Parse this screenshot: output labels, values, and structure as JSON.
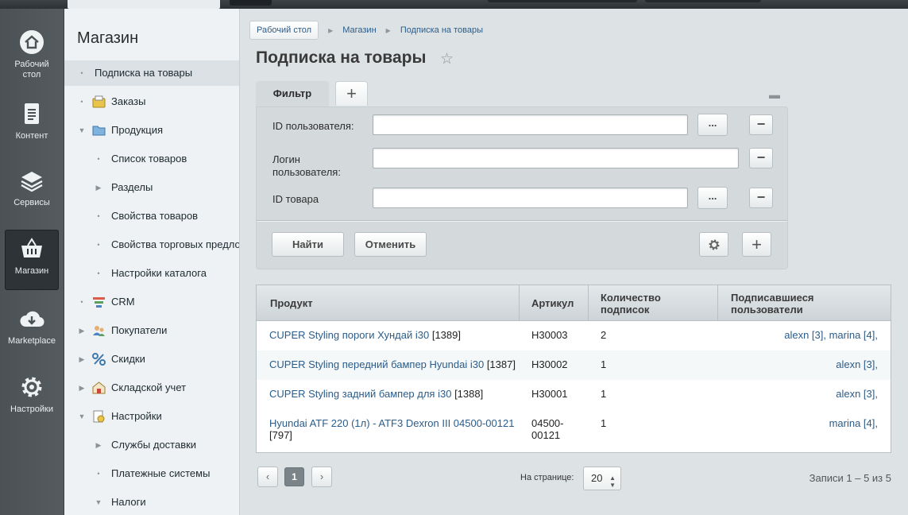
{
  "nav": [
    {
      "label": "Рабочий стол",
      "icon": "home-icon"
    },
    {
      "label": "Контент",
      "icon": "document-icon"
    },
    {
      "label": "Сервисы",
      "icon": "layers-icon"
    },
    {
      "label": "Магазин",
      "icon": "basket-icon"
    },
    {
      "label": "Marketplace",
      "icon": "cloud-download-icon"
    },
    {
      "label": "Настройки",
      "icon": "gear-icon"
    }
  ],
  "sidebar": {
    "title": "Магазин",
    "items": [
      {
        "label": "Подписка на товары",
        "marker": "•"
      },
      {
        "label": "Заказы",
        "marker": "•",
        "icon": "orders-icon"
      },
      {
        "label": "Продукция",
        "marker": "▼",
        "icon": "folder-icon"
      },
      {
        "label": "Список товаров",
        "marker": "•"
      },
      {
        "label": "Разделы",
        "marker": "▶"
      },
      {
        "label": "Свойства товаров",
        "marker": "•"
      },
      {
        "label": "Свойства торговых предложений",
        "marker": "•"
      },
      {
        "label": "Настройки каталога",
        "marker": "•"
      },
      {
        "label": "CRM",
        "marker": "•",
        "icon": "crm-icon"
      },
      {
        "label": "Покупатели",
        "marker": "▶",
        "icon": "users-icon"
      },
      {
        "label": "Скидки",
        "marker": "▶",
        "icon": "percent-icon"
      },
      {
        "label": "Складской учет",
        "marker": "▶",
        "icon": "warehouse-icon"
      },
      {
        "label": "Настройки",
        "marker": "▼",
        "icon": "settings-doc-icon"
      },
      {
        "label": "Службы доставки",
        "marker": "▶"
      },
      {
        "label": "Платежные системы",
        "marker": "•"
      },
      {
        "label": "Налоги",
        "marker": "▼"
      }
    ]
  },
  "breadcrumbs": [
    "Рабочий стол",
    "Магазин",
    "Подписка на товары"
  ],
  "page_title": "Подписка на товары",
  "filter": {
    "tab_label": "Фильтр",
    "add_tab_label": "+",
    "fields": [
      {
        "label": "ID пользователя:",
        "value": "",
        "has_dots": true
      },
      {
        "label": "Логин пользователя:",
        "value": "",
        "has_dots": false
      },
      {
        "label": "ID товара",
        "value": "",
        "has_dots": true
      }
    ],
    "dots_label": "...",
    "minus_label": "−",
    "find_label": "Найти",
    "cancel_label": "Отменить",
    "add_label": "+"
  },
  "table": {
    "columns": [
      "Продукт",
      "Артикул",
      "Количество подписок",
      "Подписавшиеся пользователи"
    ],
    "rows": [
      {
        "product": "CUPER Styling пороги Хундай i30",
        "id": "[1389]",
        "sku": "H30003",
        "count": "2",
        "users": "alexn [3], marina [4],"
      },
      {
        "product": "CUPER Styling передний бампер Hyundai i30",
        "id": "[1387]",
        "sku": "H30002",
        "count": "1",
        "users": "alexn [3],"
      },
      {
        "product": "CUPER Styling задний бампер для i30",
        "id": "[1388]",
        "sku": "H30001",
        "count": "1",
        "users": "alexn [3],"
      },
      {
        "product": "Hyundai ATF 220 (1л) - ATF3 Dexron III 04500-00121",
        "id": "[797]",
        "sku": "04500-00121",
        "count": "1",
        "users": "marina [4],"
      }
    ]
  },
  "pager": {
    "prev": "‹",
    "current": "1",
    "next": "›",
    "per_page_label": "На странице:",
    "per_page": "20",
    "records": "Записи 1 – 5 из 5"
  }
}
